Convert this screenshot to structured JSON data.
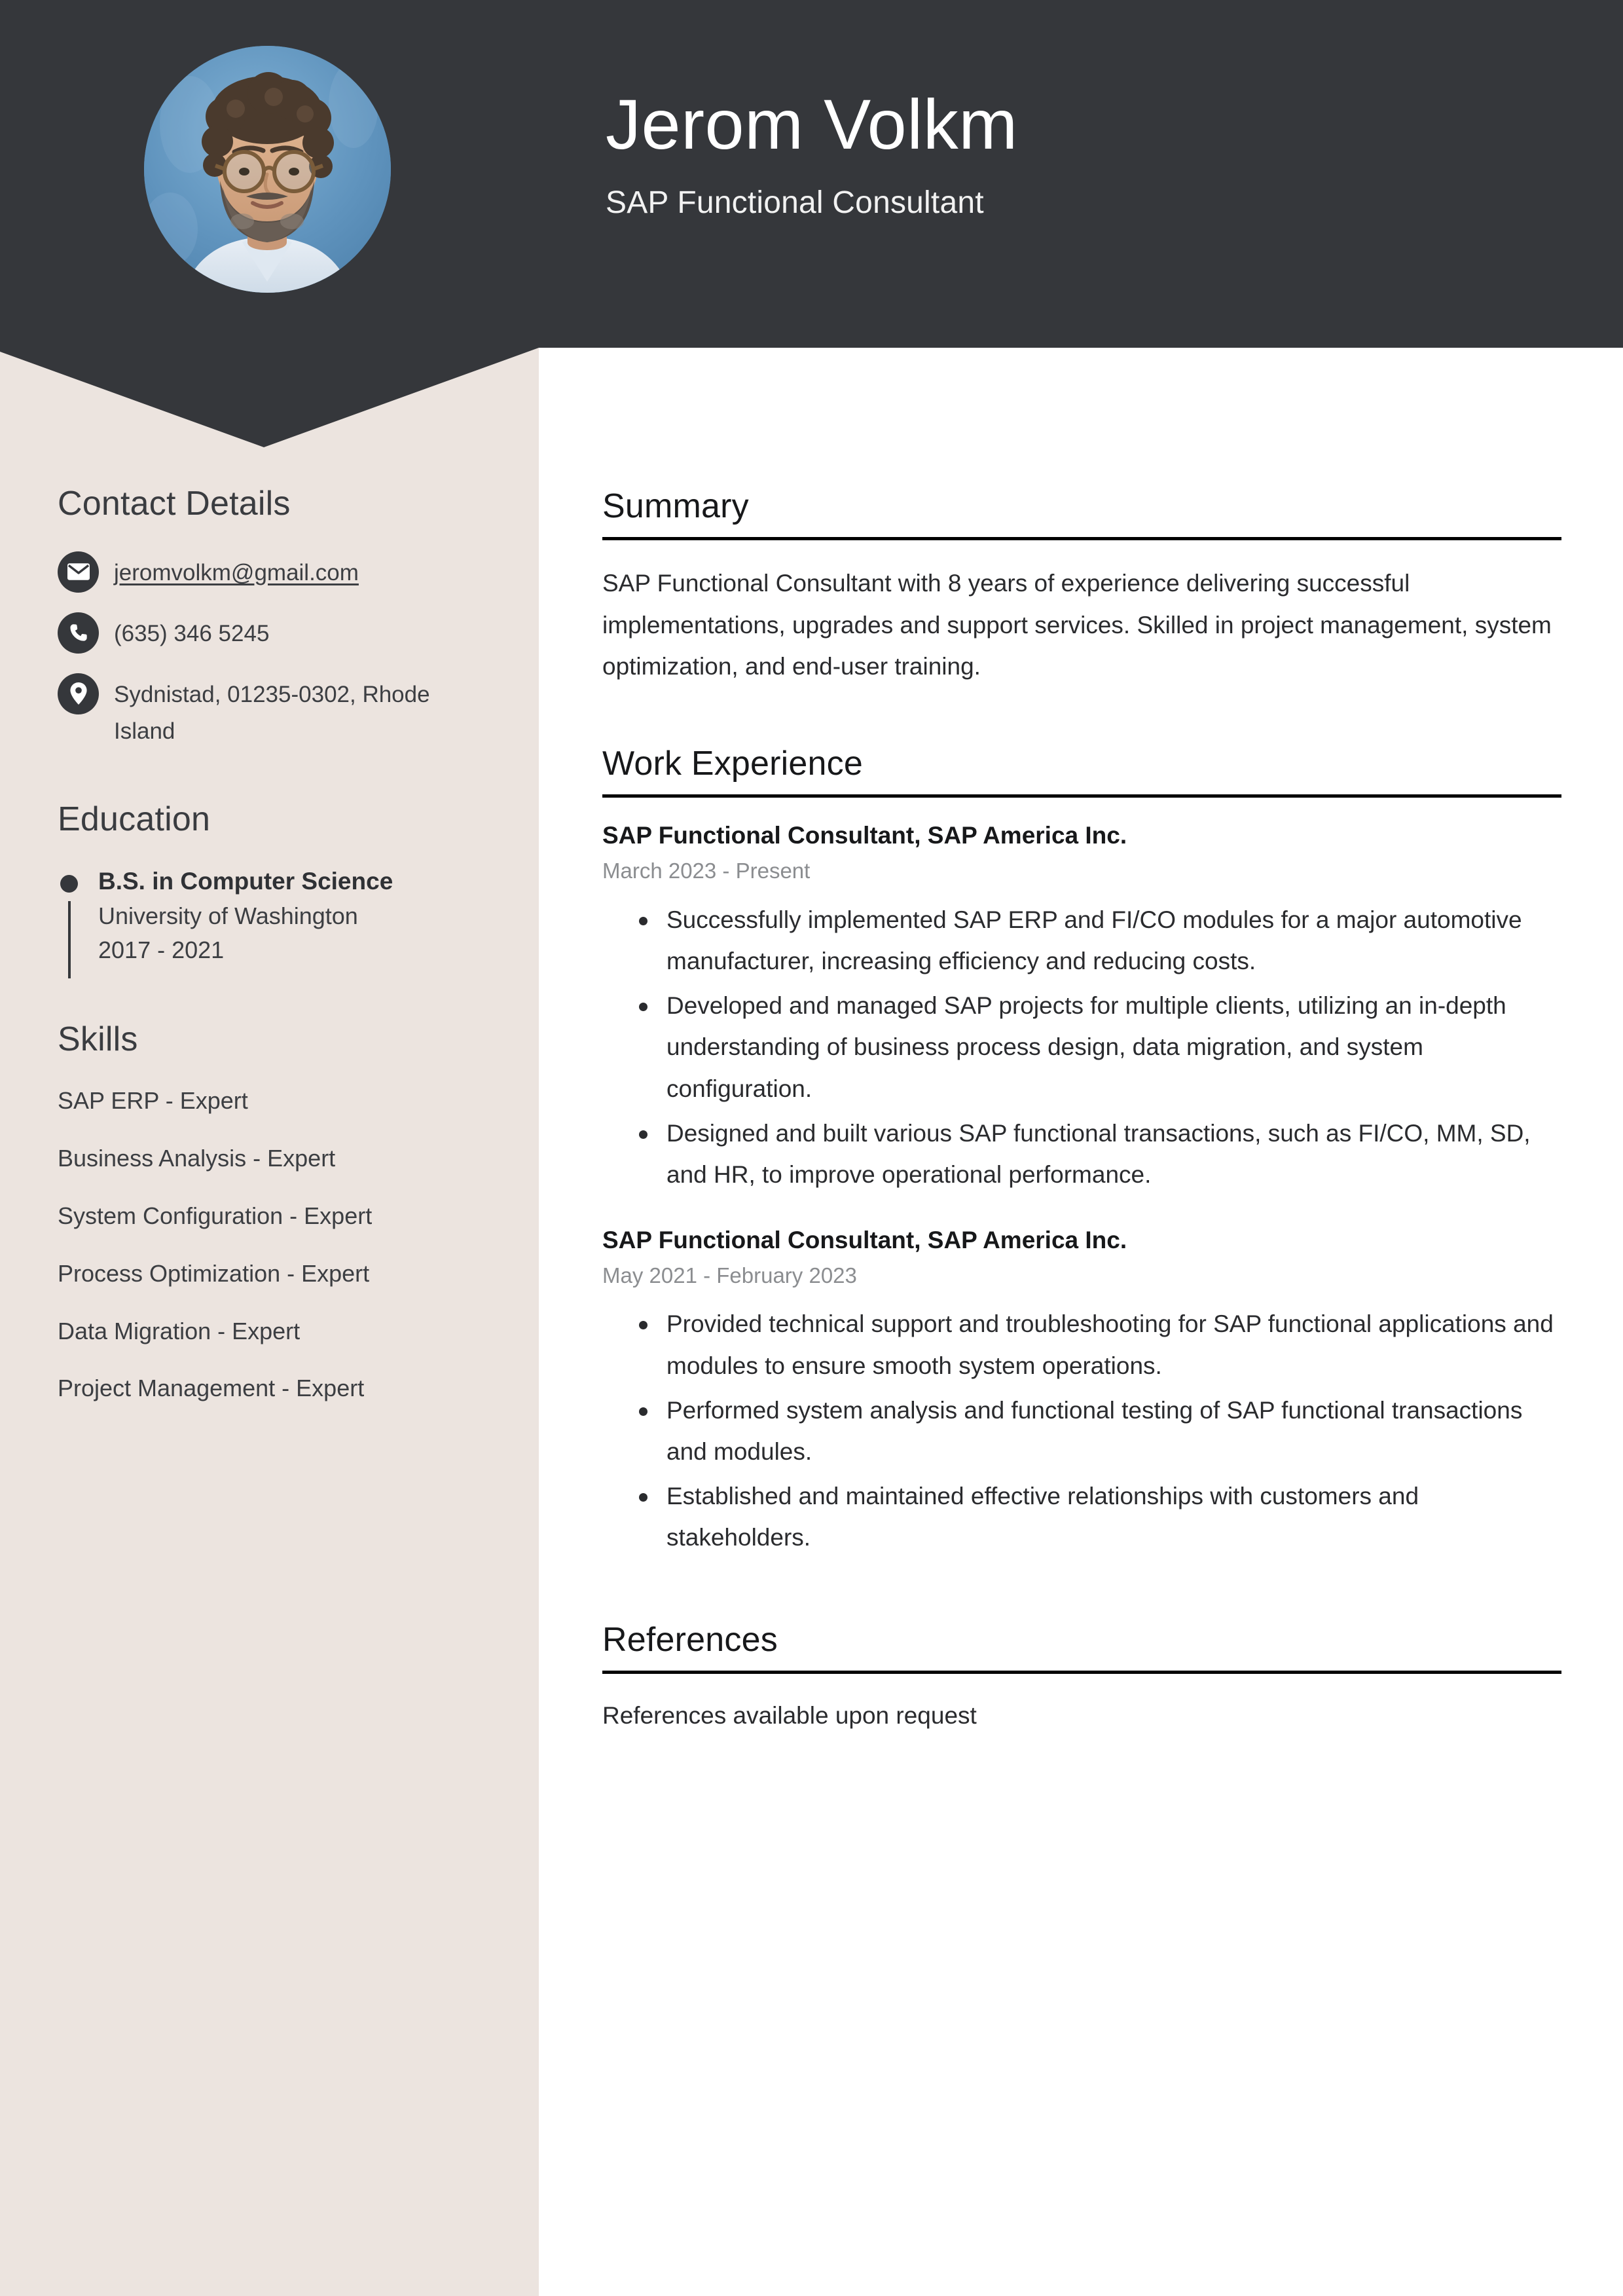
{
  "theme": {
    "header_bg": "#35373b",
    "sidebar_bg": "#ece4df",
    "page_bg": "#ffffff",
    "text_dark": "#2a2b2e",
    "muted_text": "#8b8d90",
    "rule_color": "#000000"
  },
  "header": {
    "name": "Jerom Volkm",
    "job_title": "SAP Functional Consultant",
    "avatar_alt": "profile-photo"
  },
  "sidebar": {
    "contact": {
      "heading": "Contact Details",
      "items": [
        {
          "icon": "envelope-icon",
          "value": "jeromvolkm@gmail.com",
          "is_link": true
        },
        {
          "icon": "phone-icon",
          "value": "(635) 346 5245",
          "is_link": false
        },
        {
          "icon": "location-pin-icon",
          "value": "Sydnistad, 01235-0302, Rhode Island",
          "is_link": false
        }
      ]
    },
    "education": {
      "heading": "Education",
      "items": [
        {
          "degree": "B.S. in Computer Science",
          "school": "University of Washington",
          "years": "2017 - 2021"
        }
      ]
    },
    "skills": {
      "heading": "Skills",
      "items": [
        "SAP ERP - Expert",
        "Business Analysis - Expert",
        "System Configuration - Expert",
        "Process Optimization - Expert",
        "Data Migration - Expert",
        "Project Management - Expert"
      ]
    }
  },
  "main": {
    "summary": {
      "heading": "Summary",
      "text": "SAP Functional Consultant with 8 years of experience delivering successful implementations, upgrades and support services. Skilled in project management, system optimization, and end-user training."
    },
    "work_experience": {
      "heading": "Work Experience",
      "jobs": [
        {
          "role": "SAP Functional Consultant, SAP America Inc.",
          "dates": "March 2023 - Present",
          "bullets": [
            "Successfully implemented SAP ERP and FI/CO modules for a major automotive manufacturer, increasing efficiency and reducing costs.",
            "Developed and managed SAP projects for multiple clients, utilizing an in-depth understanding of business process design, data migration, and system configuration.",
            "Designed and built various SAP functional transactions, such as FI/CO, MM, SD, and HR, to improve operational performance."
          ]
        },
        {
          "role": "SAP Functional Consultant, SAP America Inc.",
          "dates": "May 2021 - February 2023",
          "bullets": [
            "Provided technical support and troubleshooting for SAP functional applications and modules to ensure smooth system operations.",
            "Performed system analysis and functional testing of SAP functional transactions and modules.",
            "Established and maintained effective relationships with customers and stakeholders."
          ]
        }
      ]
    },
    "references": {
      "heading": "References",
      "text": "References available upon request"
    }
  }
}
